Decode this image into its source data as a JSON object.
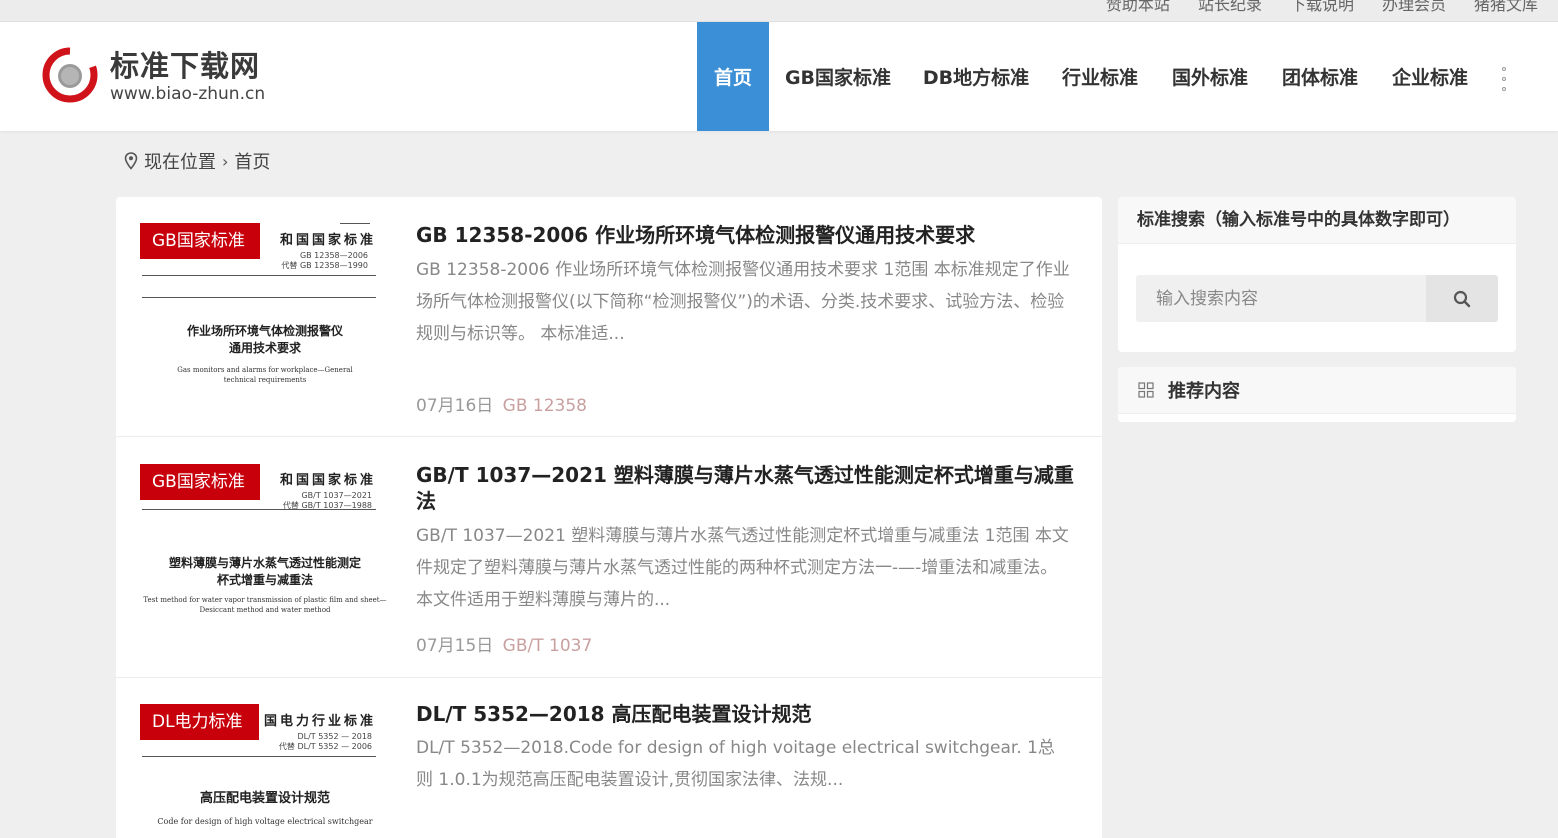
{
  "topbar": {
    "links": [
      "赞助本站",
      "站长纪录",
      "下载说明",
      "办理会员",
      "猪猪文库"
    ]
  },
  "header": {
    "site_name": "标准下载网",
    "site_url": "www.biao-zhun.cn",
    "nav": [
      {
        "label": "首页",
        "active": true
      },
      {
        "label": "GB国家标准",
        "active": false
      },
      {
        "label": "DB地方标准",
        "active": false
      },
      {
        "label": "行业标准",
        "active": false
      },
      {
        "label": "国外标准",
        "active": false
      },
      {
        "label": "团体标准",
        "active": false
      },
      {
        "label": "企业标准",
        "active": false
      }
    ],
    "more_icon": "more-vertical-icon"
  },
  "breadcrumb": {
    "location_label": "现在位置",
    "current": "首页"
  },
  "articles": [
    {
      "badge": "GB国家标准",
      "title": "GB 12358-2006 作业场所环境气体检测报警仪通用技术要求",
      "desc": "GB 12358-2006 作业场所环境气体检测报警仪通用技术要求 1范围 本标准规定了作业场所气体检测报警仪(以下简称“检测报警仪”)的术语、分类.技术要求、试验方法、检验规则与标识等。 本标准适...",
      "date": "07月16日",
      "tag": "GB 12358",
      "thumb": {
        "header": "和国国家标准",
        "code": "GB 12358—2006\n代替 GB 12358—1990",
        "title_lines": [
          "作业场所环境气体检测报警仪",
          "通用技术要求"
        ],
        "en_lines": [
          "Gas monitors and alarms for workplace—General",
          "technical requirements"
        ]
      }
    },
    {
      "badge": "GB国家标准",
      "title": "GB/T 1037—2021 塑料薄膜与薄片水蒸气透过性能测定杯式增重与减重法",
      "desc": "GB/T 1037—2021 塑料薄膜与薄片水蒸气透过性能测定杯式增重与减重法 1范围 本文件规定了塑料薄膜与薄片水蒸气透过性能的两种杯式测定方法一-—-增重法和减重法。 本文件适用于塑料薄膜与薄片的...",
      "date": "07月15日",
      "tag": "GB/T 1037",
      "thumb": {
        "header": "和国国家标准",
        "code": "GB/T 1037—2021\n代替 GB/T 1037—1988",
        "title_lines": [
          "塑料薄膜与薄片水蒸气透过性能测定",
          "杯式增重与减重法"
        ],
        "en_lines": [
          "Test method for water vapor transmission of plastic film and sheet—",
          "Desiccant method and water method"
        ]
      }
    },
    {
      "badge": "DL电力标准",
      "title": "DL/T 5352—2018 高压配电装置设计规范",
      "desc": "DL/T 5352—2018.Code for design of high voitage electrical switchgear. 1总则 1.0.1为规范高压配电装置设计,贯彻国家法律、法规...",
      "date": "",
      "tag": "",
      "thumb": {
        "header": "国电力行业标准",
        "code": "DL/T 5352 — 2018\n代替 DL/T 5352 — 2006",
        "title_lines": [
          "高压配电装置设计规范"
        ],
        "en_lines": [
          "Code for design of high voltage electrical switchgear"
        ]
      }
    }
  ],
  "sidebar": {
    "search_title": "标准搜索（输入标准号中的具体数字即可）",
    "search_placeholder": "输入搜索内容",
    "recommend_title": "推荐内容"
  },
  "colors": {
    "nav_active": "#3a8fd6",
    "badge_red": "#c7000b",
    "logo_red": "#d0121b"
  }
}
